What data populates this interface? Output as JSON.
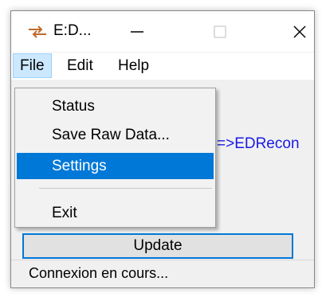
{
  "window": {
    "title": "E:D...",
    "icon": "arrows-icon"
  },
  "titlebar_buttons": [
    "minimize-icon",
    "maximize-icon",
    "close-icon"
  ],
  "menubar": {
    "items": [
      {
        "label": "File",
        "active": true
      },
      {
        "label": "Edit"
      },
      {
        "label": "Help"
      }
    ]
  },
  "file_menu": {
    "items": [
      {
        "label": "Status"
      },
      {
        "label": "Save Raw Data..."
      },
      {
        "label": "Settings",
        "selected": true
      },
      {
        "label": "Exit"
      }
    ]
  },
  "content": {
    "link_text": "=>EDRecon",
    "update_button": "Update"
  },
  "status_bar": {
    "text": "Connexion en cours..."
  },
  "colors": {
    "selection": "#0078d7",
    "menu_hover": "#cce8ff",
    "link": "#1a1ae6"
  }
}
